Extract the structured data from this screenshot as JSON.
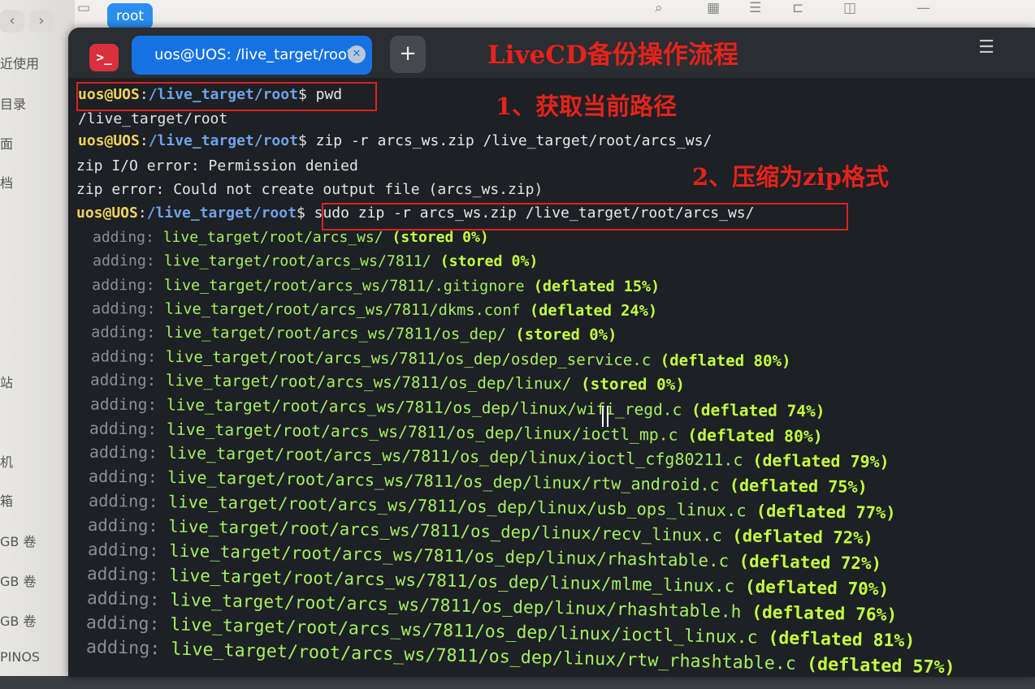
{
  "file_manager": {
    "location_chip": "root",
    "sidebar_items": [
      "近使用",
      "目录",
      "面",
      "档",
      "站",
      "机",
      "箱",
      "GB 卷",
      "GB 卷",
      "GB 卷",
      "PINOS"
    ]
  },
  "terminal": {
    "tab_title": "uos@UOS: /live_target/root",
    "new_tab_label": "+",
    "menu_icon": "hamburger-menu-icon",
    "app_icon": ">_"
  },
  "annotations": {
    "title": "LiveCD备份操作流程",
    "step1": "1、获取当前路径",
    "step2": "2、压缩为zip格式",
    "color": "#e5231b"
  },
  "prompt": {
    "user": "uos@UOS",
    "colon": ":",
    "path": "/live_target/root",
    "dollar": "$"
  },
  "session": {
    "cmd1": " pwd",
    "out1": "/live_target/root",
    "cmd2": " zip -r arcs_ws.zip /live_target/root/arcs_ws/",
    "err1": "zip I/O error: Permission denied",
    "err2": "zip error: Could not create output file (arcs_ws.zip)",
    "cmd3": " sudo zip -r arcs_ws.zip /live_target/root/arcs_ws/"
  },
  "adding_lines": [
    {
      "kw": "adding:",
      "file": "live_target/root/arcs_ws/",
      "stat": "(stored 0%)"
    },
    {
      "kw": "adding:",
      "file": "live_target/root/arcs_ws/7811/",
      "stat": "(stored 0%)"
    },
    {
      "kw": "adding:",
      "file": "live_target/root/arcs_ws/7811/.gitignore",
      "stat": "(deflated 15%)"
    },
    {
      "kw": "adding:",
      "file": "live_target/root/arcs_ws/7811/dkms.conf",
      "stat": "(deflated 24%)"
    },
    {
      "kw": "adding:",
      "file": "live_target/root/arcs_ws/7811/os_dep/",
      "stat": "(stored 0%)"
    },
    {
      "kw": "adding:",
      "file": "live_target/root/arcs_ws/7811/os_dep/osdep_service.c",
      "stat": "(deflated 80%)"
    },
    {
      "kw": "adding:",
      "file": "live_target/root/arcs_ws/7811/os_dep/linux/",
      "stat": "(stored 0%)"
    },
    {
      "kw": "adding:",
      "file": "live_target/root/arcs_ws/7811/os_dep/linux/wifi_regd.c",
      "stat": "(deflated 74%)"
    },
    {
      "kw": "adding:",
      "file": "live_target/root/arcs_ws/7811/os_dep/linux/ioctl_mp.c",
      "stat": "(deflated 80%)"
    },
    {
      "kw": "adding:",
      "file": "live_target/root/arcs_ws/7811/os_dep/linux/ioctl_cfg80211.c",
      "stat": "(deflated 79%)"
    },
    {
      "kw": "adding:",
      "file": "live_target/root/arcs_ws/7811/os_dep/linux/rtw_android.c",
      "stat": "(deflated 75%)"
    },
    {
      "kw": "adding:",
      "file": "live_target/root/arcs_ws/7811/os_dep/linux/usb_ops_linux.c",
      "stat": "(deflated 77%)"
    },
    {
      "kw": "adding:",
      "file": "live_target/root/arcs_ws/7811/os_dep/linux/recv_linux.c",
      "stat": "(deflated 72%)"
    },
    {
      "kw": "adding:",
      "file": "live_target/root/arcs_ws/7811/os_dep/linux/rhashtable.c",
      "stat": "(deflated 72%)"
    },
    {
      "kw": "adding:",
      "file": "live_target/root/arcs_ws/7811/os_dep/linux/mlme_linux.c",
      "stat": "(deflated 70%)"
    },
    {
      "kw": "adding:",
      "file": "live_target/root/arcs_ws/7811/os_dep/linux/rhashtable.h",
      "stat": "(deflated 76%)"
    },
    {
      "kw": "adding:",
      "file": "live_target/root/arcs_ws/7811/os_dep/linux/ioctl_linux.c",
      "stat": "(deflated 81%)"
    },
    {
      "kw": "adding:",
      "file": "live_target/root/arcs_ws/7811/os_dep/linux/rtw_rhashtable.c",
      "stat": "(deflated 57%)"
    }
  ]
}
